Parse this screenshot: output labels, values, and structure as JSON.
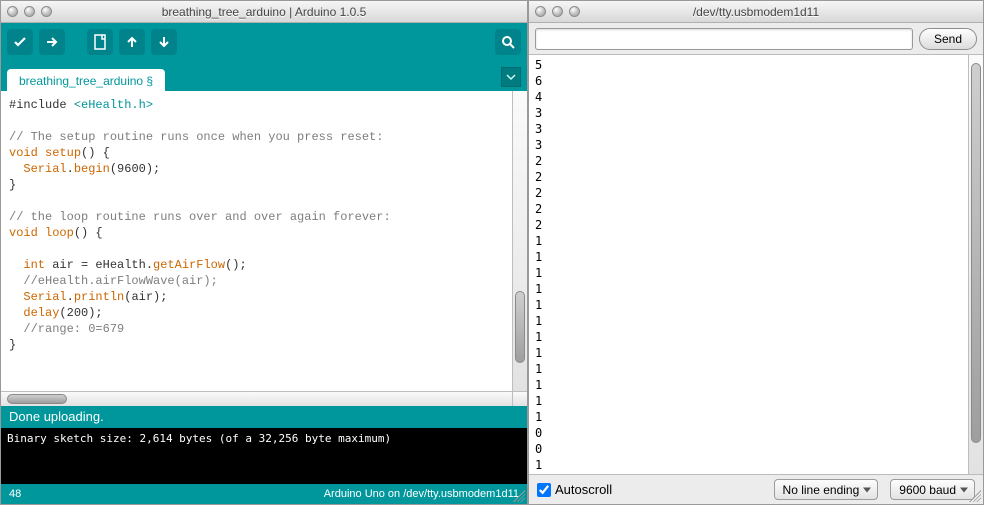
{
  "arduino_window": {
    "title": "breathing_tree_arduino | Arduino 1.0.5",
    "tab_label": "breathing_tree_arduino §",
    "toolbar_icons": {
      "verify": "verify-icon",
      "upload": "upload-icon",
      "new": "new-icon",
      "open": "open-icon",
      "save": "save-icon",
      "serial": "serial-monitor-icon"
    },
    "code_tokens": [
      {
        "t": "#include ",
        "c": ""
      },
      {
        "t": "<eHealth.h>",
        "c": "kw-teal"
      },
      {
        "t": "\n\n",
        "c": ""
      },
      {
        "t": "// The setup routine runs once when you press reset:",
        "c": "kw-gray"
      },
      {
        "t": "\n",
        "c": ""
      },
      {
        "t": "void",
        "c": "kw-orange"
      },
      {
        "t": " ",
        "c": ""
      },
      {
        "t": "setup",
        "c": "kw-orange"
      },
      {
        "t": "() {\n  ",
        "c": ""
      },
      {
        "t": "Serial",
        "c": "kw-orange"
      },
      {
        "t": ".",
        "c": ""
      },
      {
        "t": "begin",
        "c": "kw-orange"
      },
      {
        "t": "(9600);\n}\n\n",
        "c": ""
      },
      {
        "t": "// the loop routine runs over and over again forever:",
        "c": "kw-gray"
      },
      {
        "t": "\n",
        "c": ""
      },
      {
        "t": "void",
        "c": "kw-orange"
      },
      {
        "t": " ",
        "c": ""
      },
      {
        "t": "loop",
        "c": "kw-orange"
      },
      {
        "t": "() {\n\n  ",
        "c": ""
      },
      {
        "t": "int",
        "c": "kw-orange"
      },
      {
        "t": " air = eHealth.",
        "c": ""
      },
      {
        "t": "getAirFlow",
        "c": "kw-orange"
      },
      {
        "t": "();\n",
        "c": ""
      },
      {
        "t": "  //eHealth.airFlowWave(air);",
        "c": "kw-gray"
      },
      {
        "t": "\n  ",
        "c": ""
      },
      {
        "t": "Serial",
        "c": "kw-orange"
      },
      {
        "t": ".",
        "c": ""
      },
      {
        "t": "println",
        "c": "kw-orange"
      },
      {
        "t": "(air);\n  ",
        "c": ""
      },
      {
        "t": "delay",
        "c": "kw-orange"
      },
      {
        "t": "(200);\n",
        "c": ""
      },
      {
        "t": "  //range: 0=679",
        "c": "kw-gray"
      },
      {
        "t": "\n}\n",
        "c": ""
      }
    ],
    "status": "Done uploading.",
    "console": "Binary sketch size: 2,614 bytes (of a 32,256 byte maximum)",
    "footer_left": "48",
    "footer_right": "Arduino Uno on /dev/tty.usbmodem1d11"
  },
  "serial_window": {
    "title": "/dev/tty.usbmodem1d11",
    "input_value": "",
    "send_label": "Send",
    "output_lines": [
      "5",
      "6",
      "4",
      "3",
      "3",
      "3",
      "2",
      "2",
      "2",
      "2",
      "2",
      "1",
      "1",
      "1",
      "1",
      "1",
      "1",
      "1",
      "1",
      "1",
      "1",
      "1",
      "1",
      "0",
      "0",
      "1"
    ],
    "autoscroll_label": "Autoscroll",
    "autoscroll_checked": true,
    "line_ending": "No line ending",
    "baud": "9600 baud"
  }
}
